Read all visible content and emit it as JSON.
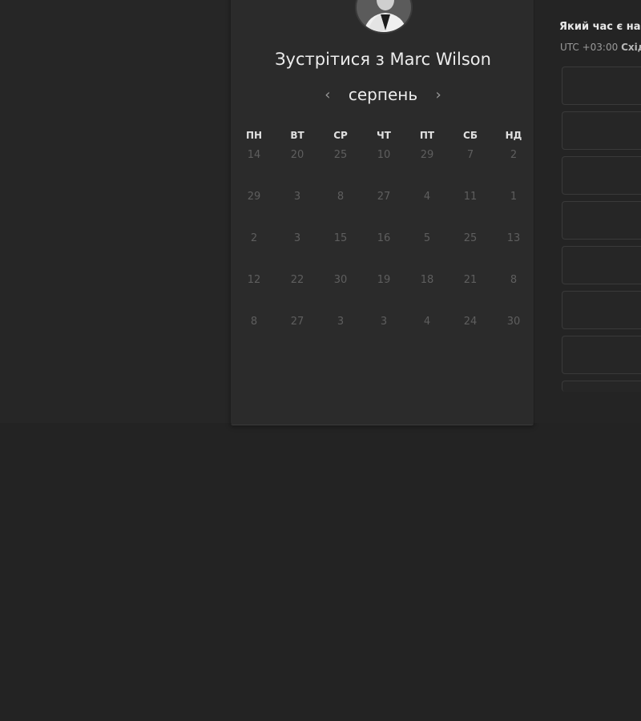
{
  "header": {
    "title": "Зустрітися з Marc Wilson"
  },
  "calendar": {
    "month": "серпень",
    "prev_symbol": "‹",
    "next_symbol": "›",
    "weekdays": [
      "ПН",
      "ВТ",
      "СР",
      "ЧТ",
      "ПТ",
      "СБ",
      "НД"
    ],
    "weeks": [
      [
        "14",
        "20",
        "25",
        "10",
        "29",
        "7",
        "2"
      ],
      [
        "29",
        "3",
        "8",
        "27",
        "4",
        "11",
        "1"
      ],
      [
        "2",
        "3",
        "15",
        "16",
        "5",
        "25",
        "13"
      ],
      [
        "12",
        "22",
        "30",
        "19",
        "18",
        "21",
        "8"
      ],
      [
        "8",
        "27",
        "3",
        "3",
        "4",
        "24",
        "30"
      ]
    ]
  },
  "time_panel": {
    "question": "Який час є на",
    "tz_prefix": "UTC +03:00",
    "tz_name": "Схід"
  },
  "colors": {
    "background": "#232323",
    "card": "#2b2b2b",
    "muted_day": "#5e5e5e"
  }
}
